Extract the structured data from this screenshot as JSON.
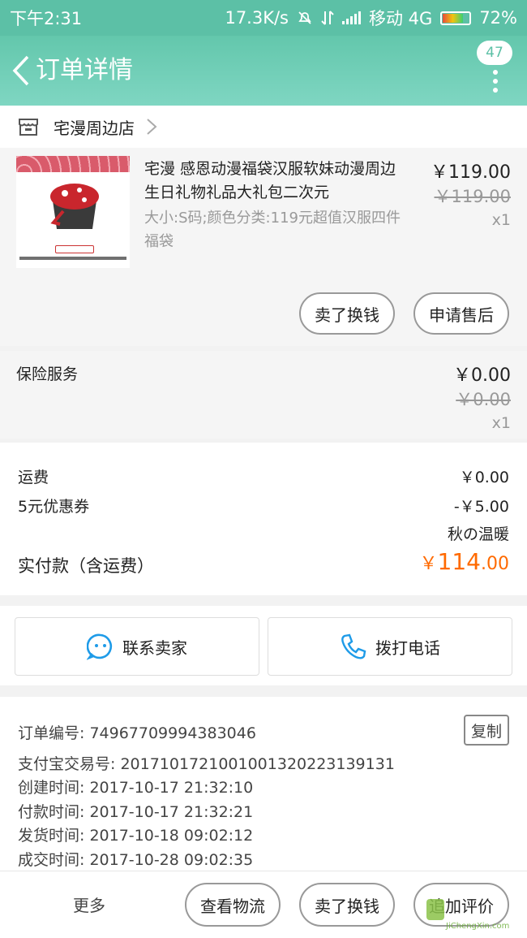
{
  "status_bar": {
    "time": "下午2:31",
    "speed": "17.3K/s",
    "carrier": "移动 4G",
    "battery": "72%",
    "battery_level": 0.72
  },
  "nav": {
    "title": "订单详情",
    "badge_count": "47"
  },
  "store": {
    "name": "宅漫周边店"
  },
  "product": {
    "title": "宅漫 感恩动漫福袋汉服软妹动漫周边生日礼物礼品大礼包二次元",
    "spec": "大小:S码;颜色分类:119元超值汉服四件福袋",
    "price": "￥119.00",
    "original_price": "￥119.00",
    "qty": "x1",
    "buttons": [
      "卖了换钱",
      "申请售后"
    ]
  },
  "insurance": {
    "label": "保险服务",
    "price": "￥0.00",
    "original_price": "￥0.00",
    "qty": "x1"
  },
  "fees": {
    "shipping_label": "运费",
    "shipping_value": "￥0.00",
    "coupon_label": "5元优惠券",
    "coupon_value": "-￥5.00",
    "coupon_note": "秋の温暖",
    "pay_label": "实付款（含运费）",
    "pay_currency": "￥",
    "pay_int": "114",
    "pay_dec": ".00"
  },
  "contact": {
    "seller_label": "联系卖家",
    "phone_label": "拨打电话"
  },
  "order_info": {
    "lines": [
      "订单编号: 74967709994383046",
      "支付宝交易号: 2017101721001001320223139131",
      "创建时间: 2017-10-17 21:32:10",
      "付款时间: 2017-10-17 21:32:21",
      "发货时间: 2017-10-18 09:02:12",
      "成交时间: 2017-10-28 09:02:35"
    ],
    "copy_label": "复制"
  },
  "bottom_bar": {
    "more_label": "更多",
    "buttons": [
      "查看物流",
      "卖了换钱",
      "追加评价"
    ],
    "watermark": "JiChengXin.com"
  },
  "colors": {
    "accent": "#5cc0a6",
    "price_orange": "#ff6a00"
  }
}
